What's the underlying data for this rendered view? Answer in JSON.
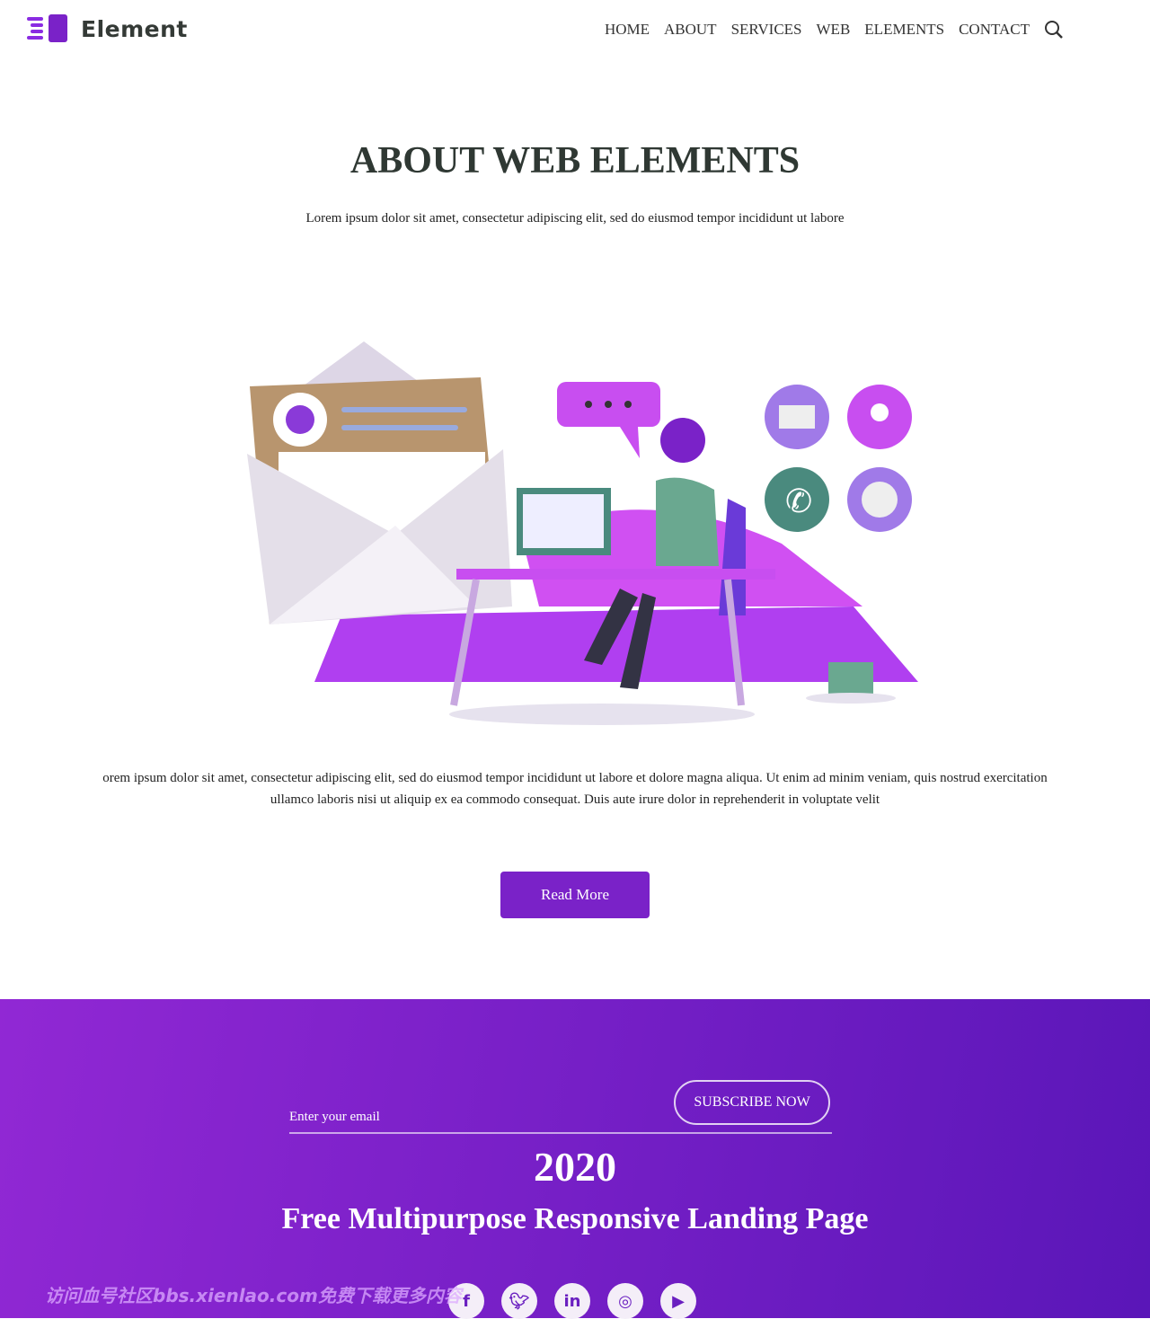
{
  "header": {
    "brand": "Element",
    "nav": [
      "HOME",
      "ABOUT",
      "SERVICES",
      "WEB",
      "ELEMENTS",
      "CONTACT"
    ],
    "accent": "#7a22c8"
  },
  "about": {
    "title": "ABOUT WEB ELEMENTS",
    "intro": "Lorem ipsum dolor sit amet, consectetur adipiscing elit, sed do eiusmod tempor incididunt ut labore",
    "body": "orem ipsum dolor sit amet, consectetur adipiscing elit, sed do eiusmod tempor incididunt ut labore et dolore magna aliqua. Ut enim ad minim veniam, quis nostrud exercitation ullamco laboris nisi ut aliquip ex ea commodo consequat. Duis aute irure dolor in reprehenderit in voluptate velit",
    "button": "Read More"
  },
  "footer": {
    "email_placeholder": "Enter your email",
    "subscribe": "SUBSCRIBE NOW",
    "year": "2020",
    "tagline": "Free Multipurpose Responsive Landing Page",
    "social": [
      "facebook-icon",
      "twitter-icon",
      "linkedin-icon",
      "instagram-icon",
      "youtube-icon"
    ],
    "watermark": "访问血号社区bbs.xienlao.com免费下载更多内容"
  }
}
